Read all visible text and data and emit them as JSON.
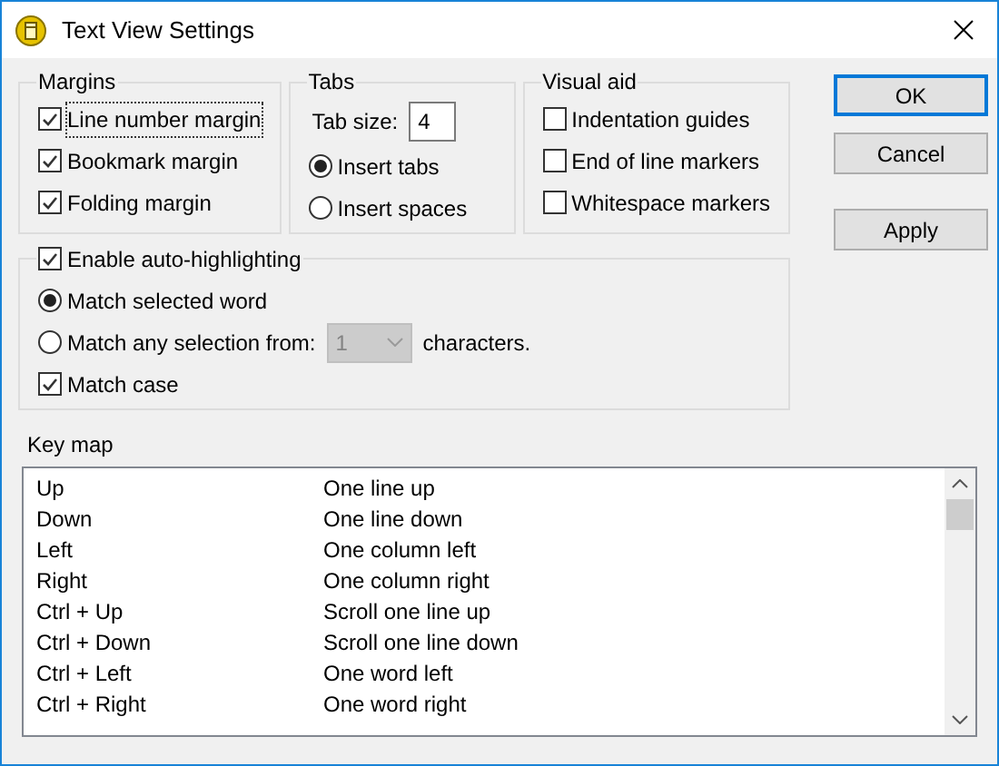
{
  "window": {
    "title": "Text View Settings"
  },
  "margins": {
    "title": "Margins",
    "options": [
      {
        "label": "Line number margin",
        "checked": true,
        "focused": true
      },
      {
        "label": "Bookmark margin",
        "checked": true,
        "focused": false
      },
      {
        "label": "Folding margin",
        "checked": true,
        "focused": false
      }
    ]
  },
  "tabs": {
    "title": "Tabs",
    "tab_size_label": "Tab size:",
    "tab_size": "4",
    "options": [
      {
        "label": "Insert tabs",
        "selected": true
      },
      {
        "label": "Insert spaces",
        "selected": false
      }
    ]
  },
  "visual_aid": {
    "title": "Visual aid",
    "options": [
      {
        "label": "Indentation guides",
        "checked": false
      },
      {
        "label": "End of line markers",
        "checked": false
      },
      {
        "label": "Whitespace markers",
        "checked": false
      }
    ]
  },
  "buttons": [
    {
      "label": "OK",
      "default": true
    },
    {
      "label": "Cancel",
      "default": false
    },
    {
      "label": "Apply",
      "default": false
    }
  ],
  "auto_highlighting": {
    "label": "Enable auto-highlighting",
    "checked": true,
    "options": [
      {
        "label": "Match selected word",
        "selected": true
      },
      {
        "label": "Match any selection from:",
        "selected": false
      }
    ],
    "min_chars": {
      "value": "1",
      "disabled": true
    },
    "suffix": "characters.",
    "match_case": {
      "label": "Match case",
      "checked": true
    }
  },
  "key_map": {
    "title": "Key map",
    "rows": [
      {
        "key": "Up",
        "action": "One line up"
      },
      {
        "key": "Down",
        "action": "One line down"
      },
      {
        "key": "Left",
        "action": "One column left"
      },
      {
        "key": "Right",
        "action": "One column right"
      },
      {
        "key": "Ctrl + Up",
        "action": "Scroll one line up"
      },
      {
        "key": "Ctrl + Down",
        "action": "Scroll one line down"
      },
      {
        "key": "Ctrl + Left",
        "action": "One word left"
      },
      {
        "key": "Ctrl + Right",
        "action": "One word right"
      }
    ]
  }
}
